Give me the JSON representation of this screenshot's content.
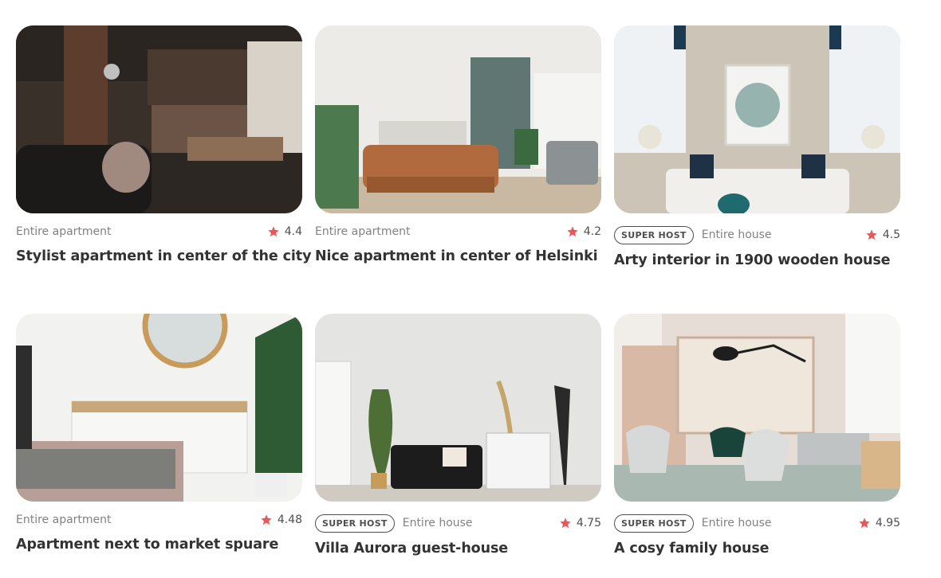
{
  "colors": {
    "star": "#eb5757",
    "badge_border": "#4f4f4f",
    "muted_text": "#828282",
    "title_text": "#333333"
  },
  "listings": [
    {
      "badge": "",
      "type": "Entire apartment",
      "rating": "4.4",
      "title": "Stylist apartment in center of the city",
      "image": "loft-interior-photo"
    },
    {
      "badge": "",
      "type": "Entire apartment",
      "rating": "4.2",
      "title": "Nice apartment in center of Helsinki",
      "image": "living-room-sofa-photo"
    },
    {
      "badge": "SUPER HOST",
      "type": "Entire house",
      "rating": "4.5",
      "title": "Arty interior in 1900 wooden house",
      "image": "white-sofa-windows-photo"
    },
    {
      "badge": "",
      "type": "Entire apartment",
      "rating": "4.48",
      "title": "Apartment next to market spuare",
      "image": "bedroom-mirror-plant-photo"
    },
    {
      "badge": "SUPER HOST",
      "type": "Entire house",
      "rating": "4.75",
      "title": "Villa Aurora guest-house",
      "image": "black-sofa-lamp-photo"
    },
    {
      "badge": "SUPER HOST",
      "type": "Entire house",
      "rating": "4.95",
      "title": "A cosy family house",
      "image": "lounge-chairs-photo"
    }
  ]
}
